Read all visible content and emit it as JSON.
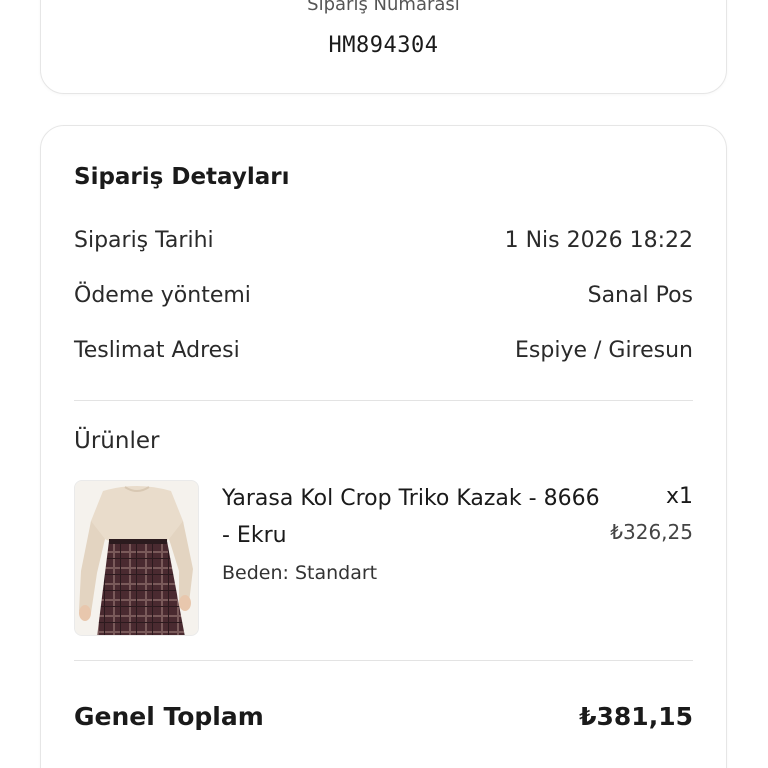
{
  "order": {
    "number_label": "Sipariş Numarası",
    "number": "HM894304"
  },
  "details": {
    "title": "Sipariş Detayları",
    "date_label": "Sipariş Tarihi",
    "date_value": "1 Nis 2026 18:22",
    "payment_label": "Ödeme yöntemi",
    "payment_value": "Sanal Pos",
    "address_label": "Teslimat Adresi",
    "address_value": "Espiye / Giresun"
  },
  "products": {
    "title": "Ürünler",
    "items": [
      {
        "name": "Yarasa Kol Crop Triko Kazak - 8666 - Ekru",
        "size": "Beden: Standart",
        "quantity": "x1",
        "price": "₺326,25",
        "image": "product-photo-beige-sweater-plaid-skirt"
      }
    ]
  },
  "total": {
    "label": "Genel Toplam",
    "value": "₺381,15"
  },
  "colors": {
    "background": "#ffffff",
    "card_border": "#e6e6e6",
    "text_primary": "#1a1a1a",
    "divider": "#e3e3e3"
  }
}
